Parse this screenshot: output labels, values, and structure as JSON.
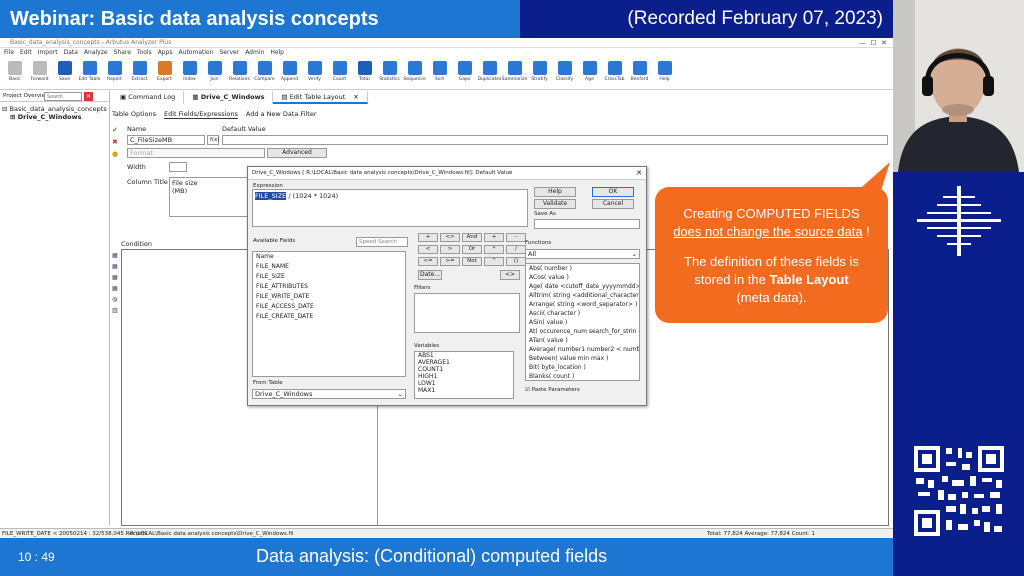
{
  "header": {
    "title": "Webinar: Basic data analysis concepts",
    "recorded": "(Recorded February 07, 2023)"
  },
  "footer": {
    "time": "10 : 49",
    "caption": "Data analysis: (Conditional) computed fields"
  },
  "app": {
    "window_title": "Basic_data_analysis_concepts - Arbutus Analyzer Plus",
    "menu": [
      "File",
      "Edit",
      "Import",
      "Data",
      "Analyze",
      "Share",
      "Tools",
      "Apps",
      "Automation",
      "Server",
      "Admin",
      "Help"
    ],
    "toolbar": [
      {
        "label": "Back",
        "color": "#bbbbbb"
      },
      {
        "label": "Forward",
        "color": "#bbbbbb"
      },
      {
        "label": "Save",
        "color": "#1d5fb8"
      },
      {
        "label": "Edit Table",
        "color": "#2b78d6"
      },
      {
        "label": "Report",
        "color": "#2b78d6"
      },
      {
        "label": "Extract",
        "color": "#2b78d6"
      },
      {
        "label": "Export",
        "color": "#d97b2a"
      },
      {
        "label": "Index",
        "color": "#2b78d6"
      },
      {
        "label": "Join",
        "color": "#2b78d6"
      },
      {
        "label": "Relations",
        "color": "#2b78d6"
      },
      {
        "label": "Compare",
        "color": "#2b78d6"
      },
      {
        "label": "Append",
        "color": "#2b78d6"
      },
      {
        "label": "Verify",
        "color": "#2b78d6"
      },
      {
        "label": "Count",
        "color": "#2b78d6"
      },
      {
        "label": "Total",
        "color": "#1d5fb8"
      },
      {
        "label": "Statistics",
        "color": "#2b78d6"
      },
      {
        "label": "Sequence",
        "color": "#2b78d6"
      },
      {
        "label": "Sort",
        "color": "#2b78d6"
      },
      {
        "label": "Gaps",
        "color": "#2b78d6"
      },
      {
        "label": "Duplicates",
        "color": "#2b78d6"
      },
      {
        "label": "Summarize",
        "color": "#2b78d6"
      },
      {
        "label": "Stratify",
        "color": "#2b78d6"
      },
      {
        "label": "Classify",
        "color": "#2b78d6"
      },
      {
        "label": "Age",
        "color": "#2b78d6"
      },
      {
        "label": "CrossTab",
        "color": "#2b78d6"
      },
      {
        "label": "Benford",
        "color": "#2b78d6"
      },
      {
        "label": "Help",
        "color": "#2b78d6"
      }
    ],
    "project_overview": {
      "label": "Project Overview",
      "search_placeholder": "Search",
      "root": "Basic_data_analysis_concepts",
      "child": "Drive_C_Windows"
    },
    "tabs": [
      "Command Log",
      "Drive_C_Windows",
      "Edit Table Layout"
    ],
    "subtabs": [
      "Table Options",
      "Edit Fields/Expressions",
      "Add a New Data Filter"
    ],
    "form": {
      "name_label": "Name",
      "name_value": "C_FileSizeMB",
      "default_label": "Default Value",
      "fx": "f(x)",
      "format_label": "Format",
      "advanced": "Advanced",
      "width_label": "Width",
      "column_title_label": "Column Title",
      "column_title_value": "File size\n(MB)",
      "condition_label": "Condition"
    },
    "dialog": {
      "title": "Drive_C_Windows [ R:\\LOCAL\\Basic data analysis concepts\\Drive_C_Windows.fil]: Default Value",
      "expression_label": "Expression",
      "expression_selected": "FILE_SIZE",
      "expression_rest": " / (1024 * 1024)",
      "help": "Help",
      "ok": "OK",
      "validate": "Validate",
      "cancel": "Cancel",
      "save_as": "Save As",
      "available_fields_label": "Available Fields",
      "speed_search": "Speed Search",
      "fields": [
        "Name",
        "FILE_NAME",
        "FILE_SIZE",
        "FILE_ATTRIBUTES",
        "FILE_WRITE_DATE",
        "FILE_ACCESS_DATE",
        "FILE_CREATE_DATE"
      ],
      "operators": [
        "+",
        "<>",
        "And",
        "+",
        "-",
        "<",
        ">",
        "Or",
        "*",
        "/",
        "<=",
        ">=",
        "Not",
        "^",
        "()"
      ],
      "date_btn": "Date...",
      "arrow_btn": "<>",
      "filters_label": "Filters",
      "variables_label": "Variables",
      "variables": [
        "ABS1",
        "AVERAGE1",
        "COUNT1",
        "HIGH1",
        "LOW1",
        "MAX1"
      ],
      "functions_label": "Functions",
      "functions_select": "All",
      "functions": [
        "Abs( number )",
        "ACos( value )",
        "Age( date <cutoff_date_yyyymmdd>",
        "Alltrim( string <additional_character",
        "Arrange( string <word_separator> )",
        "Ascii( character )",
        "ASin( value )",
        "At( occurence_num  search_for_strin",
        "ATan( value )",
        "Average( number1  number2 < numb",
        "Between( value  min  max )",
        "Bit( byte_location )",
        "Blanks( count )"
      ],
      "from_table_label": "From Table",
      "from_table": "Drive_C_Windows",
      "paste_params": "Paste Parameters"
    },
    "status": {
      "left": "FILE_WRITE_DATE <  20050214 : 32/538,045 Records",
      "path": "R:\\LOCAL\\Basic data analysis concepts\\Drive_C_Windows.fil",
      "totals": "Total: 77,824  Average: 77,824  Count: 1"
    }
  },
  "callout": {
    "line1": "Creating COMPUTED FIELDS",
    "line2": "does not change the source data",
    "line2_suffix": " !",
    "line3": "The definition of these fields is",
    "line4a": "stored in the ",
    "line4b": "Table Layout",
    "line5": "(meta data)."
  },
  "colors": {
    "accent_blue": "#1d77d2",
    "dark_blue": "#0a1e8c",
    "callout": "#f36b1f"
  }
}
